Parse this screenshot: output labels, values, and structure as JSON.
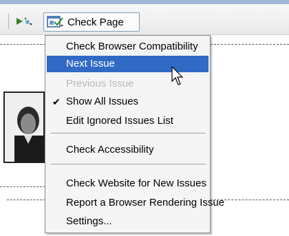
{
  "toolbar": {
    "check_page_label": "Check Page",
    "icon_button": "arrow-dropdown-icon"
  },
  "menu": {
    "items": [
      {
        "label": "Check Browser Compatibility",
        "state": "normal"
      },
      {
        "label": "Next Issue",
        "state": "selected"
      },
      {
        "label": "Previous Issue",
        "state": "disabled"
      },
      {
        "label": "Show All Issues",
        "state": "checked"
      },
      {
        "label": "Edit Ignored Issues List",
        "state": "normal"
      },
      {
        "label": "Check Accessibility",
        "state": "normal"
      },
      {
        "label": "Check Website for New Issues",
        "state": "normal"
      },
      {
        "label": "Report a Browser Rendering Issue",
        "state": "normal"
      },
      {
        "label": "Settings...",
        "state": "normal"
      }
    ],
    "check_glyph": "✔"
  },
  "colors": {
    "selection": "#316ac5",
    "disabled_text": "#b8b8b8",
    "strip": "#9fb6d6"
  }
}
